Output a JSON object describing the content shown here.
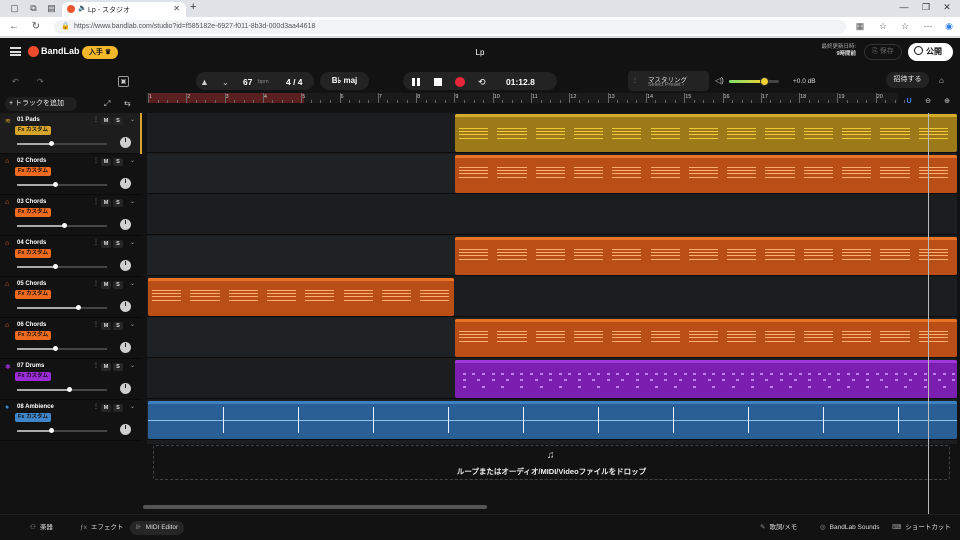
{
  "browser": {
    "tab_title": "Lp - スタジオ",
    "url": "https://www.bandlab.com/studio?id=f585182e-6927-f011-8b3d-000d3aa44618"
  },
  "app": {
    "logo_text": "BandLab",
    "get_label": "入手",
    "project_title": "Lp",
    "last_saved_label": "最終更新日時:",
    "last_saved_value": "9時間前",
    "save_label": "保存",
    "publish_label": "公開",
    "invite_label": "招待する"
  },
  "transport": {
    "bpm": "67",
    "bpm_unit": "bpm",
    "time_signature": "4 / 4",
    "key": "B♭ maj",
    "time": "01:12.8",
    "mastering_label": "マスタリング",
    "mastering_preset": "Select Preset ›",
    "master_volume_db": "+0.0 dB",
    "master_volume_level": 0.7
  },
  "tracks_panel": {
    "add_track_label": "トラックを追加",
    "fx_label": "Fx カスタム",
    "mute_label": "M",
    "solo_label": "S",
    "tracks": [
      {
        "name": "01  Pads",
        "color": "#d6a52a",
        "icon": "synth-icon",
        "volume": 0.38
      },
      {
        "name": "02  Chords",
        "color": "#ee6a1e",
        "icon": "keys-icon",
        "volume": 0.42
      },
      {
        "name": "03  Chords",
        "color": "#ee6a1e",
        "icon": "keys-icon",
        "volume": 0.52
      },
      {
        "name": "04  Chords",
        "color": "#ee6a1e",
        "icon": "keys-icon",
        "volume": 0.42
      },
      {
        "name": "05  Chords",
        "color": "#ee6a1e",
        "icon": "keys-icon",
        "volume": 0.68
      },
      {
        "name": "06  Chords",
        "color": "#ee6a1e",
        "icon": "keys-icon",
        "volume": 0.42
      },
      {
        "name": "07  Drums",
        "color": "#9b2bd6",
        "icon": "drums-icon",
        "volume": 0.58
      },
      {
        "name": "08  Ambience",
        "color": "#3e86c9",
        "icon": "mic-icon",
        "volume": 0.38
      }
    ]
  },
  "timeline": {
    "bars": [
      "1",
      "2",
      "3",
      "4",
      "5",
      "6",
      "7",
      "8",
      "9",
      "10",
      "11",
      "12",
      "13",
      "14",
      "15",
      "16",
      "17",
      "18",
      "19",
      "20"
    ]
  },
  "drop_zone_text": "ループまたはオーディオ/MIDI/Videoファイルをドロップ",
  "bottom_bar": {
    "instrument_label": "楽器",
    "effects_label": "エフェクト",
    "midi_editor_label": "MIDI Editor",
    "lyrics_label": "歌詞/メモ",
    "sounds_label": "BandLab Sounds",
    "shortcuts_label": "ショートカット"
  }
}
